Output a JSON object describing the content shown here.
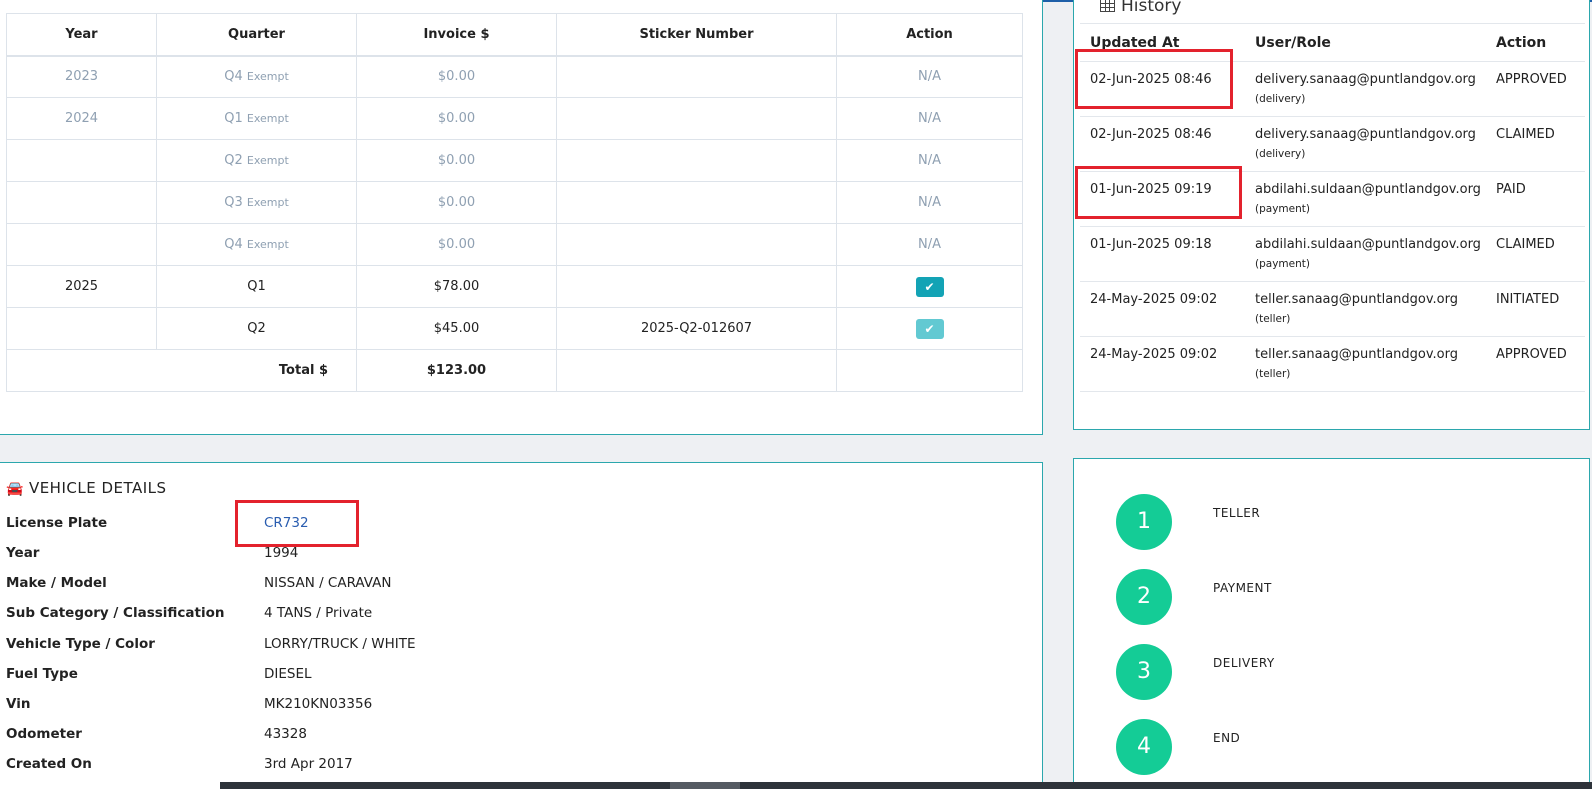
{
  "invoice_table": {
    "headers": [
      "Year",
      "Quarter",
      "Invoice $",
      "Sticker Number",
      "Action"
    ],
    "rows": [
      {
        "year": "2023",
        "quarter": "Q4",
        "note": "Exempt",
        "invoice": "$0.00",
        "sticker": "",
        "action": "N/A",
        "exempt": true
      },
      {
        "year": "2024",
        "quarter": "Q1",
        "note": "Exempt",
        "invoice": "$0.00",
        "sticker": "",
        "action": "N/A",
        "exempt": true
      },
      {
        "year": "",
        "quarter": "Q2",
        "note": "Exempt",
        "invoice": "$0.00",
        "sticker": "",
        "action": "N/A",
        "exempt": true
      },
      {
        "year": "",
        "quarter": "Q3",
        "note": "Exempt",
        "invoice": "$0.00",
        "sticker": "",
        "action": "N/A",
        "exempt": true
      },
      {
        "year": "",
        "quarter": "Q4",
        "note": "Exempt",
        "invoice": "$0.00",
        "sticker": "",
        "action": "N/A",
        "exempt": true
      },
      {
        "year": "2025",
        "quarter": "Q1",
        "note": "",
        "invoice": "$78.00",
        "sticker": "",
        "action": "check-icon",
        "exempt": false
      },
      {
        "year": "",
        "quarter": "Q2",
        "note": "",
        "invoice": "$45.00",
        "sticker": "2025-Q2-012607",
        "action": "check-icon",
        "exempt": false
      }
    ],
    "total_label": "Total $",
    "total_value": "$123.00"
  },
  "history": {
    "title": "History",
    "icon": "table-icon",
    "headers": [
      "Updated At",
      "User/Role",
      "Action"
    ],
    "rows": [
      {
        "updated_at": "02-Jun-2025 08:46",
        "user": "delivery.sanaag@puntlandgov.org",
        "role": "(delivery)",
        "action": "APPROVED"
      },
      {
        "updated_at": "02-Jun-2025 08:46",
        "user": "delivery.sanaag@puntlandgov.org",
        "role": "(delivery)",
        "action": "CLAIMED"
      },
      {
        "updated_at": "01-Jun-2025 09:19",
        "user": "abdilahi.suldaan@puntlandgov.org",
        "role": "(payment)",
        "action": "PAID"
      },
      {
        "updated_at": "01-Jun-2025 09:18",
        "user": "abdilahi.suldaan@puntlandgov.org",
        "role": "(payment)",
        "action": "CLAIMED"
      },
      {
        "updated_at": "24-May-2025 09:02",
        "user": "teller.sanaag@puntlandgov.org",
        "role": "(teller)",
        "action": "INITIATED"
      },
      {
        "updated_at": "24-May-2025 09:02",
        "user": "teller.sanaag@puntlandgov.org",
        "role": "(teller)",
        "action": "APPROVED"
      }
    ]
  },
  "vehicle": {
    "title": "VEHICLE DETAILS",
    "icon": "car-icon",
    "fields": [
      {
        "label": "License Plate",
        "value": "CR732",
        "link": true
      },
      {
        "label": "Year",
        "value": "1994"
      },
      {
        "label": "Make / Model",
        "value": "NISSAN / CARAVAN"
      },
      {
        "label": "Sub Category / Classification",
        "value": "4 TANS / Private"
      },
      {
        "label": "Vehicle Type / Color",
        "value": "LORRY/TRUCK / WHITE"
      },
      {
        "label": "Fuel Type",
        "value": "DIESEL"
      },
      {
        "label": "Vin",
        "value": "MK210KN03356"
      },
      {
        "label": "Odometer",
        "value": "43328"
      },
      {
        "label": "Created On",
        "value": "3rd Apr 2017"
      }
    ]
  },
  "workflow_steps": [
    {
      "number": "1",
      "label": "TELLER"
    },
    {
      "number": "2",
      "label": "PAYMENT"
    },
    {
      "number": "3",
      "label": "DELIVERY"
    },
    {
      "number": "4",
      "label": "END"
    }
  ],
  "colors": {
    "panel_border": "#2ba7ad",
    "check_button": "#13a3b5",
    "step_circle": "#14cc96",
    "highlight_box": "#e3222d",
    "link": "#2a5db0"
  }
}
